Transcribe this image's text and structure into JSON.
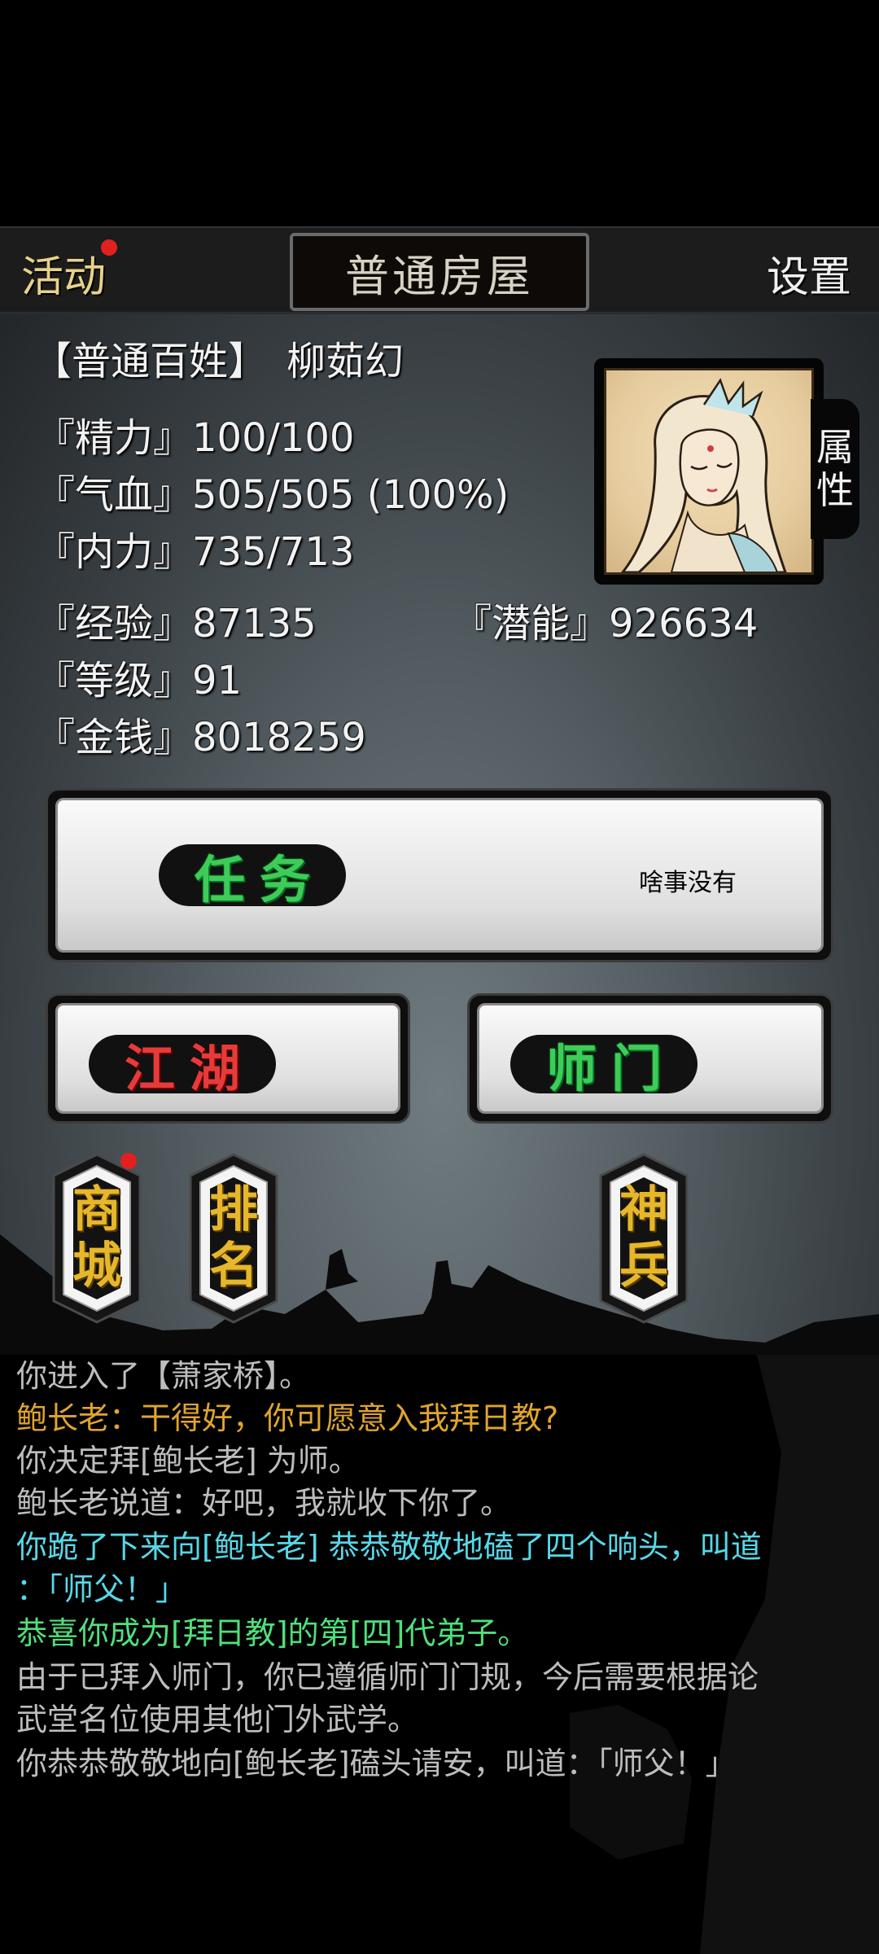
{
  "header": {
    "activity_label": "活动",
    "location_title": "普通房屋",
    "settings_label": "设置"
  },
  "character": {
    "title_line": "【普通百姓】　柳茹幻",
    "stats": [
      "『精力』100/100",
      "『气血』505/505 (100%)",
      "『内力』735/713",
      "『经验』87135",
      "『潜能』926634",
      "『等级』91",
      "『金钱』8018259"
    ],
    "attr_tab": [
      "属",
      "性"
    ]
  },
  "task": {
    "label": "任务",
    "status": "啥事没有"
  },
  "jianghu": {
    "label": "江湖"
  },
  "shimen": {
    "label": "师门"
  },
  "side_buttons": [
    {
      "chars": [
        "商",
        "城"
      ],
      "has_dot": true
    },
    {
      "chars": [
        "排",
        "名"
      ],
      "has_dot": false
    },
    {
      "chars": [
        "神",
        "兵"
      ],
      "has_dot": false
    }
  ],
  "log": {
    "lines": [
      {
        "text": "你进入了【萧家桥】。",
        "color": "#bdbdbd"
      },
      {
        "text": "鲍长老：干得好，你可愿意入我拜日教?",
        "color": "#e0a42e"
      },
      {
        "text": "你决定拜[鲍长老] 为师。",
        "color": "#bdbdbd"
      },
      {
        "text": "鲍长老说道：好吧，我就收下你了。",
        "color": "#bdbdbd"
      },
      {
        "text": "你跪了下来向[鲍长老] 恭恭敬敬地磕了四个响头，叫道",
        "color": "#56d8e8"
      },
      {
        "text": "：「师父！」",
        "color": "#56d8e8"
      },
      {
        "text": "恭喜你成为[拜日教]的第[四]代弟子。",
        "color": "#4fe07a"
      },
      {
        "text": "由于已拜入师门，你已遵循师门门规，今后需要根据论",
        "color": "#bdbdbd"
      },
      {
        "text": "武堂名位使用其他门外武学。",
        "color": "#bdbdbd"
      },
      {
        "text": "你恭恭敬敬地向[鲍长老]磕头请安，叫道：「师父！」",
        "color": "#bdbdbd"
      }
    ]
  },
  "colors": {
    "notification_dot": "#e12020",
    "gold_text": "#e6b72a",
    "green_label": "#3fcb58",
    "red_label": "#e73a3a"
  }
}
